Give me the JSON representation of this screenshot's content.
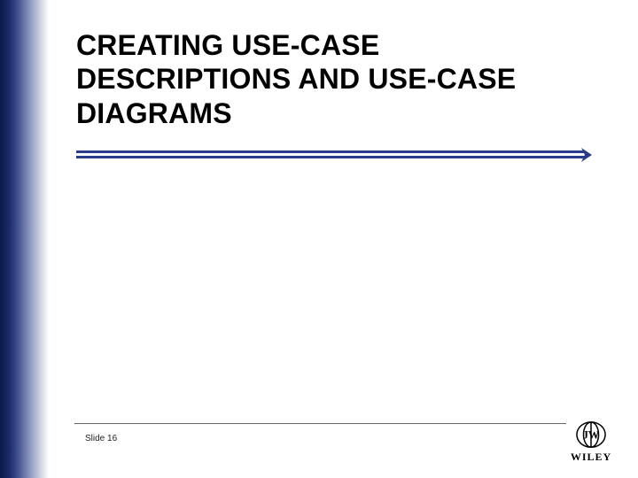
{
  "slide": {
    "title": "CREATING USE-CASE DESCRIPTIONS AND USE-CASE DIAGRAMS",
    "footer_label": "Slide 16"
  },
  "brand": {
    "name": "WILEY"
  },
  "colors": {
    "accent": "#2a3a8a",
    "gradient_dark": "#0a1a4a",
    "text": "#000000"
  }
}
